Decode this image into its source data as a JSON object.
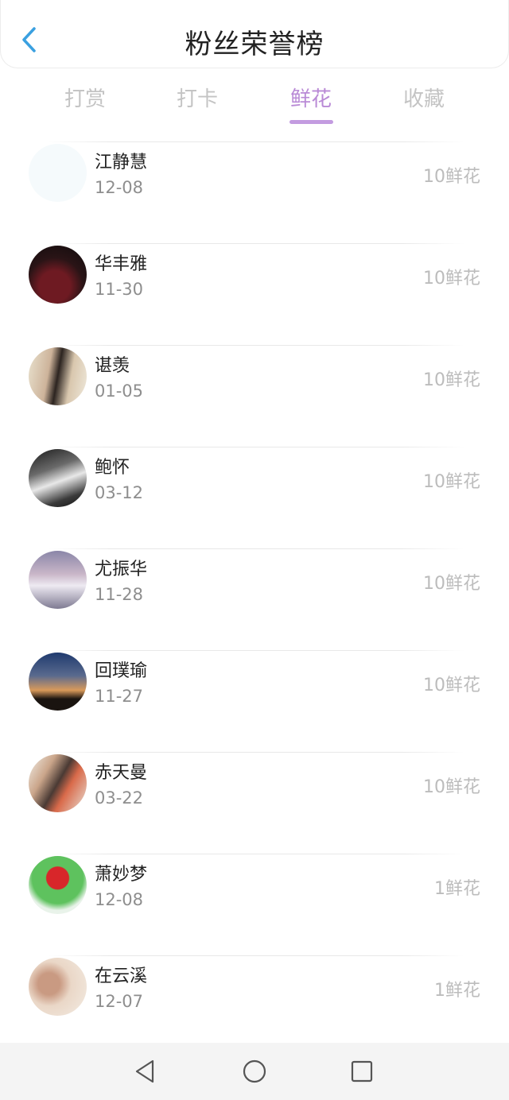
{
  "header": {
    "title": "粉丝荣誉榜",
    "back_icon": "chevron-left-icon",
    "accent": "#3aa0e0"
  },
  "tabs": [
    {
      "label": "打赏",
      "active": false
    },
    {
      "label": "打卡",
      "active": false
    },
    {
      "label": "鲜花",
      "active": true
    },
    {
      "label": "收藏",
      "active": false
    }
  ],
  "tab_active_color": "#b98ad6",
  "list": [
    {
      "name": "江静慧",
      "date": "12-08",
      "amount": "10鲜花"
    },
    {
      "name": "华丰雅",
      "date": "11-30",
      "amount": "10鲜花"
    },
    {
      "name": "谌羡",
      "date": "01-05",
      "amount": "10鲜花"
    },
    {
      "name": "鲍怀",
      "date": "03-12",
      "amount": "10鲜花"
    },
    {
      "name": "尤振华",
      "date": "11-28",
      "amount": "10鲜花"
    },
    {
      "name": "回璞瑜",
      "date": "11-27",
      "amount": "10鲜花"
    },
    {
      "name": "赤天曼",
      "date": "03-22",
      "amount": "10鲜花"
    },
    {
      "name": "萧妙梦",
      "date": "12-08",
      "amount": "1鲜花"
    },
    {
      "name": "在云溪",
      "date": "12-07",
      "amount": "1鲜花"
    }
  ],
  "navbar": {
    "back_icon": "triangle-back-icon",
    "home_icon": "circle-home-icon",
    "recents_icon": "square-recents-icon"
  }
}
